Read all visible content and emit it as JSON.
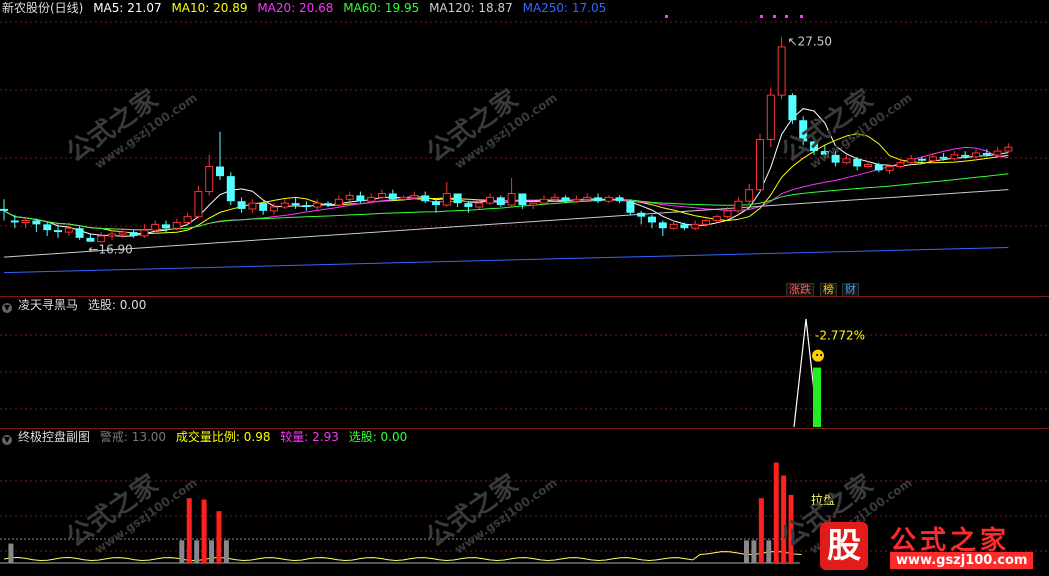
{
  "main": {
    "stock_name": "新农股份(日线)",
    "ma": [
      {
        "label": "MA5: 21.07",
        "color": "#ffffff"
      },
      {
        "label": "MA10: 20.89",
        "color": "#ffff00"
      },
      {
        "label": "MA20: 20.68",
        "color": "#ff33ff"
      },
      {
        "label": "MA60: 19.95",
        "color": "#33ff33"
      },
      {
        "label": "MA120: 18.87",
        "color": "#cccccc"
      },
      {
        "label": "MA250: 17.05",
        "color": "#3366ff"
      }
    ],
    "high_label": "27.50",
    "low_label": "16.90",
    "tags": [
      {
        "text": "涨跌",
        "color": "#ff5555"
      },
      {
        "text": "榜",
        "color": "#ffcc00"
      },
      {
        "text": "财",
        "color": "#33aaff"
      }
    ]
  },
  "ind1": {
    "name": "凌天寻黑马",
    "select_label": "选股: 0.00",
    "pct_label": "-2.772%"
  },
  "ind2": {
    "name": "终极控盘副图",
    "warn_label": "警戒: 13.00",
    "ratio_label": "成交量比例: 0.98",
    "big_label": "较量: 2.93",
    "select_label": "选股: 0.00",
    "pull_label": "拉盘"
  },
  "watermark": {
    "text": "公式之家",
    "url": "www.gszj100.com"
  },
  "brand": {
    "gu": "股",
    "name": "公式之家",
    "url": "www.gszj100.com"
  },
  "colors": {
    "up": "#ff3232",
    "down": "#54ffff",
    "grid": "#7a1a1a"
  },
  "chart_data": {
    "type": "candlestick",
    "price_range": [
      14.5,
      28.5
    ],
    "high": 27.5,
    "low": 16.9,
    "candles": [
      [
        18.6,
        18.5,
        19.1,
        18.0
      ],
      [
        18.0,
        17.9,
        18.3,
        17.6
      ],
      [
        17.9,
        18.0,
        18.2,
        17.6
      ],
      [
        18.0,
        17.8,
        18.1,
        17.4
      ],
      [
        17.8,
        17.5,
        17.9,
        17.2
      ],
      [
        17.5,
        17.4,
        17.8,
        17.1
      ],
      [
        17.4,
        17.6,
        17.9,
        17.2
      ],
      [
        17.6,
        17.1,
        17.7,
        17.0
      ],
      [
        17.1,
        16.9,
        17.3,
        16.9
      ],
      [
        16.9,
        17.2,
        17.4,
        16.9
      ],
      [
        17.2,
        17.3,
        17.5,
        17.0
      ],
      [
        17.3,
        17.4,
        17.6,
        17.1
      ],
      [
        17.4,
        17.2,
        17.5,
        17.1
      ],
      [
        17.2,
        17.5,
        17.8,
        17.1
      ],
      [
        17.5,
        17.8,
        18.0,
        17.4
      ],
      [
        17.8,
        17.6,
        18.0,
        17.4
      ],
      [
        17.6,
        17.9,
        18.1,
        17.5
      ],
      [
        17.9,
        18.2,
        18.4,
        17.7
      ],
      [
        18.2,
        19.5,
        19.8,
        18.1
      ],
      [
        19.5,
        20.8,
        21.4,
        19.3
      ],
      [
        20.8,
        20.3,
        22.6,
        20.1
      ],
      [
        20.3,
        19.0,
        20.5,
        18.8
      ],
      [
        19.0,
        18.6,
        19.2,
        18.4
      ],
      [
        18.6,
        18.9,
        19.1,
        18.4
      ],
      [
        18.9,
        18.5,
        19.0,
        18.3
      ],
      [
        18.5,
        18.7,
        18.9,
        18.3
      ],
      [
        18.7,
        18.9,
        19.1,
        18.6
      ],
      [
        18.9,
        18.8,
        19.2,
        18.6
      ],
      [
        18.8,
        18.7,
        19.0,
        18.5
      ],
      [
        18.7,
        18.9,
        19.1,
        18.5
      ],
      [
        18.9,
        18.8,
        19.0,
        18.7
      ],
      [
        18.8,
        19.1,
        19.3,
        18.7
      ],
      [
        19.1,
        19.3,
        19.5,
        19.0
      ],
      [
        19.3,
        19.0,
        19.5,
        18.9
      ],
      [
        19.0,
        19.2,
        19.4,
        18.9
      ],
      [
        19.2,
        19.4,
        19.6,
        19.1
      ],
      [
        19.4,
        19.1,
        19.6,
        19.0
      ],
      [
        19.1,
        19.2,
        19.3,
        19.0
      ],
      [
        19.2,
        19.3,
        19.5,
        19.1
      ],
      [
        19.3,
        19.0,
        19.5,
        18.9
      ],
      [
        19.0,
        18.8,
        19.1,
        18.4
      ],
      [
        18.8,
        19.4,
        20.0,
        18.7
      ],
      [
        19.4,
        18.9,
        19.4,
        18.7
      ],
      [
        18.9,
        18.7,
        19.0,
        18.4
      ],
      [
        18.7,
        18.9,
        19.0,
        18.6
      ],
      [
        18.9,
        19.2,
        19.4,
        18.8
      ],
      [
        19.2,
        18.8,
        19.3,
        18.7
      ],
      [
        18.8,
        19.4,
        20.2,
        18.7
      ],
      [
        19.4,
        18.8,
        19.4,
        18.6
      ],
      [
        18.8,
        18.9,
        19.0,
        18.6
      ],
      [
        18.9,
        19.1,
        19.3,
        18.8
      ],
      [
        19.1,
        19.2,
        19.4,
        19.0
      ],
      [
        19.2,
        19.0,
        19.3,
        18.9
      ],
      [
        19.0,
        19.1,
        19.3,
        18.9
      ],
      [
        19.1,
        19.2,
        19.4,
        19.0
      ],
      [
        19.2,
        19.0,
        19.4,
        18.9
      ],
      [
        19.0,
        19.2,
        19.3,
        18.9
      ],
      [
        19.2,
        19.0,
        19.3,
        18.9
      ],
      [
        19.0,
        18.4,
        19.1,
        18.3
      ],
      [
        18.4,
        18.2,
        18.5,
        17.8
      ],
      [
        18.2,
        17.9,
        18.3,
        17.6
      ],
      [
        17.9,
        17.6,
        18.0,
        17.2
      ],
      [
        17.6,
        17.8,
        18.0,
        17.5
      ],
      [
        17.8,
        17.6,
        17.9,
        17.5
      ],
      [
        17.6,
        17.8,
        18.0,
        17.5
      ],
      [
        17.8,
        18.0,
        18.1,
        17.7
      ],
      [
        18.0,
        18.2,
        18.3,
        17.9
      ],
      [
        18.2,
        18.5,
        18.7,
        18.1
      ],
      [
        18.5,
        19.0,
        19.2,
        18.4
      ],
      [
        19.0,
        19.6,
        19.9,
        18.8
      ],
      [
        19.6,
        22.2,
        22.5,
        19.5
      ],
      [
        22.2,
        24.5,
        24.9,
        21.8
      ],
      [
        24.5,
        27.0,
        27.5,
        24.3
      ],
      [
        24.5,
        23.2,
        24.6,
        23.0
      ],
      [
        23.2,
        22.1,
        23.4,
        21.9
      ],
      [
        22.1,
        21.6,
        22.3,
        21.4
      ],
      [
        21.6,
        21.4,
        21.9,
        21.1
      ],
      [
        21.4,
        21.0,
        21.6,
        20.8
      ],
      [
        21.0,
        21.2,
        21.4,
        20.9
      ],
      [
        21.2,
        20.8,
        21.3,
        20.6
      ],
      [
        20.8,
        20.9,
        21.1,
        20.7
      ],
      [
        20.9,
        20.6,
        21.0,
        20.5
      ],
      [
        20.6,
        20.8,
        20.9,
        20.4
      ],
      [
        20.8,
        21.0,
        21.2,
        20.7
      ],
      [
        21.0,
        21.2,
        21.4,
        20.9
      ],
      [
        21.2,
        21.1,
        21.3,
        21.0
      ],
      [
        21.1,
        21.3,
        21.5,
        21.0
      ],
      [
        21.3,
        21.2,
        21.5,
        21.1
      ],
      [
        21.2,
        21.4,
        21.6,
        21.1
      ],
      [
        21.4,
        21.3,
        21.6,
        21.2
      ],
      [
        21.3,
        21.5,
        21.7,
        21.2
      ],
      [
        21.5,
        21.4,
        21.7,
        21.3
      ],
      [
        21.4,
        21.6,
        21.8,
        21.3
      ],
      [
        21.6,
        21.8,
        22.0,
        21.5
      ]
    ],
    "ind1_peak": 1.0,
    "ind1_bar": 0.55,
    "ind2_bars": [
      {
        "i": 1,
        "v": 0.3,
        "c": "#888888"
      },
      {
        "i": 24,
        "v": 0.35,
        "c": "#888888"
      },
      {
        "i": 25,
        "v": 1.0,
        "c": "#ff2020"
      },
      {
        "i": 26,
        "v": 0.35,
        "c": "#888888"
      },
      {
        "i": 27,
        "v": 0.98,
        "c": "#ff2020"
      },
      {
        "i": 28,
        "v": 0.35,
        "c": "#888888"
      },
      {
        "i": 29,
        "v": 0.8,
        "c": "#ff2020"
      },
      {
        "i": 30,
        "v": 0.35,
        "c": "#888888"
      },
      {
        "i": 100,
        "v": 0.35,
        "c": "#888888"
      },
      {
        "i": 101,
        "v": 0.35,
        "c": "#888888"
      },
      {
        "i": 102,
        "v": 1.0,
        "c": "#ff2020"
      },
      {
        "i": 103,
        "v": 0.35,
        "c": "#888888"
      },
      {
        "i": 104,
        "v": 1.55,
        "c": "#ff2020"
      },
      {
        "i": 105,
        "v": 1.35,
        "c": "#ff2020"
      },
      {
        "i": 106,
        "v": 1.05,
        "c": "#ff2020"
      }
    ]
  }
}
